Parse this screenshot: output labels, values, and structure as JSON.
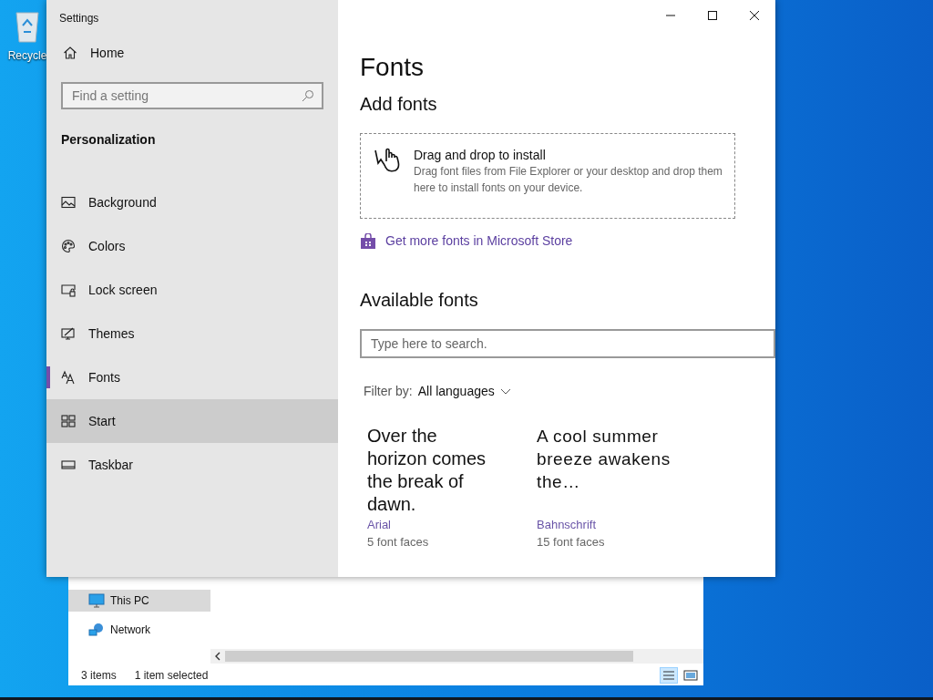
{
  "desktop": {
    "icons": [
      {
        "label": "Recycle"
      }
    ]
  },
  "explorer": {
    "nav": [
      {
        "label": "This PC",
        "selected": true,
        "kind": "pc"
      },
      {
        "label": "Network",
        "selected": false,
        "kind": "network"
      }
    ],
    "status_bar": [
      "3 items",
      "1 item selected"
    ]
  },
  "settings": {
    "window": {
      "title": "Settings"
    },
    "sidebar": {
      "home": "Home",
      "search": {
        "placeholder": "Find a setting"
      },
      "section": "Personalization",
      "items": [
        {
          "label": "Background",
          "kind": "background",
          "selected": false,
          "hovered": false
        },
        {
          "label": "Colors",
          "kind": "colors",
          "selected": false,
          "hovered": false
        },
        {
          "label": "Lock screen",
          "kind": "lock",
          "selected": false,
          "hovered": false
        },
        {
          "label": "Themes",
          "kind": "themes",
          "selected": false,
          "hovered": false
        },
        {
          "label": "Fonts",
          "kind": "fonts",
          "selected": true,
          "hovered": false
        },
        {
          "label": "Start",
          "kind": "start",
          "selected": false,
          "hovered": true
        },
        {
          "label": "Taskbar",
          "kind": "taskbar",
          "selected": false,
          "hovered": false
        }
      ]
    },
    "content": {
      "title": "Fonts",
      "add_heading": "Add fonts",
      "drop_zone": {
        "title": "Drag and drop to install",
        "description": "Drag font files from File Explorer or your desktop and drop them here to install fonts on your device."
      },
      "store_link": "Get more fonts in Microsoft Store",
      "available_heading": "Available fonts",
      "search": {
        "placeholder": "Type here to search."
      },
      "filter": {
        "label": "Filter by:",
        "value": "All languages"
      },
      "fonts": [
        {
          "preview": "Over the horizon comes the break of dawn.",
          "name": "Arial",
          "faces": "5 font faces",
          "kind": "arial"
        },
        {
          "preview": "A cool summer breeze awakens the…",
          "name": "Bahnschrift",
          "faces": "15 font faces",
          "kind": "bahnschrift"
        }
      ]
    }
  }
}
